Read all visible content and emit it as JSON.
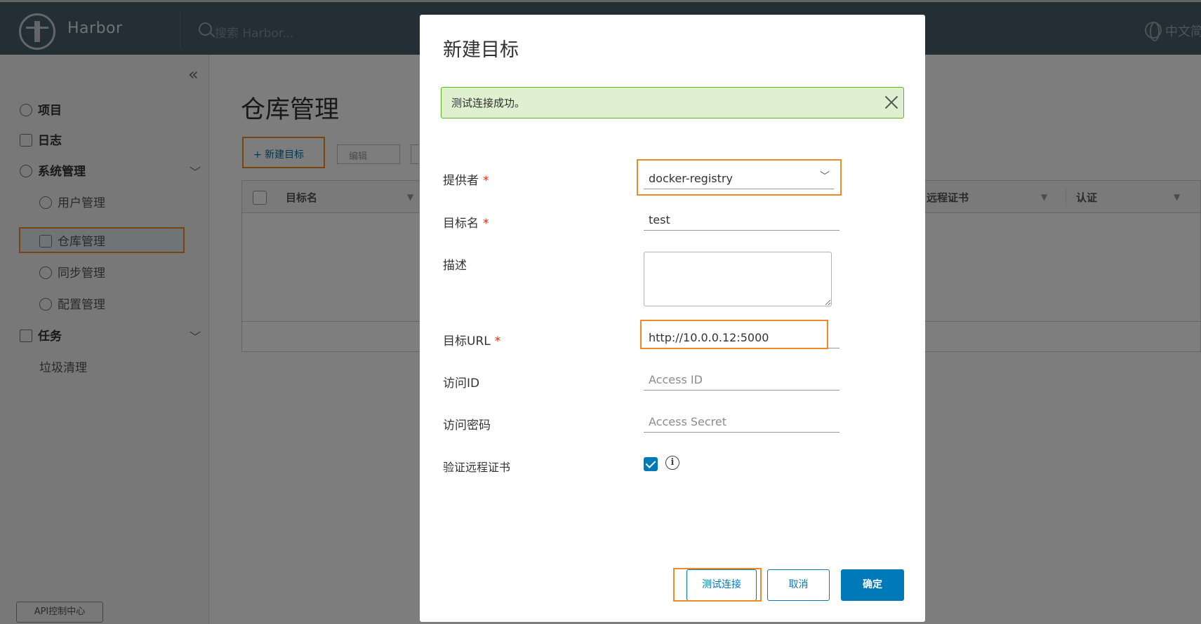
{
  "header": {
    "brand": "Harbor",
    "search_placeholder": "搜索 Harbor...",
    "language": "中文简体"
  },
  "sidebar": {
    "items": [
      {
        "label": "项目",
        "icon": "project-icon"
      },
      {
        "label": "日志",
        "icon": "log-icon"
      },
      {
        "label": "系统管理",
        "icon": "admin-icon"
      },
      {
        "label": "用户管理",
        "icon": "users-icon"
      },
      {
        "label": "仓库管理",
        "icon": "registry-icon",
        "active": true
      },
      {
        "label": "同步管理",
        "icon": "replication-icon"
      },
      {
        "label": "配置管理",
        "icon": "config-icon"
      },
      {
        "label": "任务",
        "icon": "tasks-icon"
      },
      {
        "label": "垃圾清理",
        "icon": ""
      }
    ],
    "api_button": "API控制中心"
  },
  "main": {
    "title": "仓库管理",
    "new_button": "+ 新建目标",
    "edit_button": "编辑",
    "columns": [
      "目标名",
      "远程证书",
      "认证"
    ]
  },
  "modal": {
    "title": "新建目标",
    "alert": "测试连接成功。",
    "fields": {
      "provider": {
        "label": "提供者",
        "value": "docker-registry"
      },
      "name": {
        "label": "目标名",
        "value": "test"
      },
      "description": {
        "label": "描述",
        "value": ""
      },
      "url": {
        "label": "目标URL",
        "value": "http://10.0.0.12:5000"
      },
      "access_id": {
        "label": "访问ID",
        "placeholder": "Access ID"
      },
      "access_secret": {
        "label": "访问密码",
        "placeholder": "Access Secret"
      },
      "verify_cert": {
        "label": "验证远程证书",
        "checked": true
      }
    },
    "required_mark": "*",
    "buttons": {
      "test": "测试连接",
      "cancel": "取消",
      "ok": "确定"
    }
  },
  "colors": {
    "header": "#485d6b",
    "accent": "#0079b8",
    "highlight": "#f08a24",
    "success_bg": "#dff0d0",
    "success_border": "#5eb715",
    "required": "#e62700"
  }
}
